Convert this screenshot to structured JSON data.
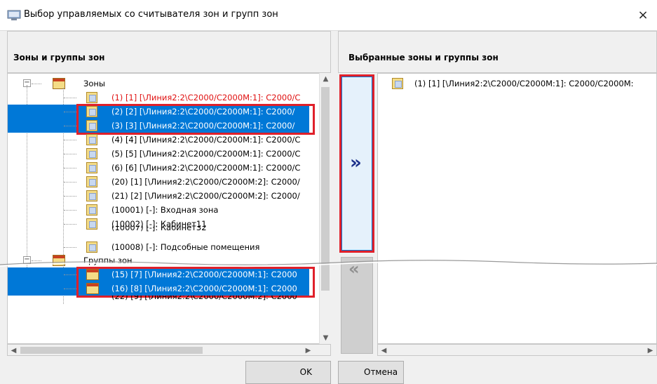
{
  "window": {
    "title": "Выбор управляемых со считывателя зон и групп зон",
    "close_icon": "×"
  },
  "left": {
    "header": "Зоны и группы зон",
    "tree": {
      "zones_label": "Зоны",
      "zones": [
        {
          "text": "(1) [1] [\\Линия2:2\\C2000/C2000M:1]: C2000/C",
          "state": "red"
        },
        {
          "text": "(2) [2] [\\Линия2:2\\C2000/C2000M:1]: C2000/",
          "state": "selected"
        },
        {
          "text": "(3) [3] [\\Линия2:2\\C2000/C2000M:1]: C2000/",
          "state": "selected"
        },
        {
          "text": "(4) [4] [\\Линия2:2\\C2000/C2000M:1]: C2000/C",
          "state": "normal"
        },
        {
          "text": "(5) [5] [\\Линия2:2\\C2000/C2000M:1]: C2000/C",
          "state": "normal"
        },
        {
          "text": "(6) [6] [\\Линия2:2\\C2000/C2000M:1]: C2000/C",
          "state": "normal"
        },
        {
          "text": "(20) [1] [\\Линия2:2\\C2000/C2000M:2]: C2000/",
          "state": "normal"
        },
        {
          "text": "(21) [2] [\\Линия2:2\\C2000/C2000M:2]: C2000/",
          "state": "normal"
        },
        {
          "text": "(10001) [-]: Входная зона",
          "state": "normal"
        },
        {
          "text": "(10002) [-]: Кабинет11",
          "state": "normal"
        },
        {
          "text": "(10007) [-]: Кабинет32",
          "state": "normal"
        },
        {
          "text": "(10008) [-]: Подсобные помещения",
          "state": "normal"
        }
      ],
      "groups_label": "Группы зон",
      "groups": [
        {
          "text": "(15) [7] [\\Линия2:2\\C2000/C2000M:1]: C2000",
          "state": "selected"
        },
        {
          "text": "(16) [8] [\\Линия2:2\\C2000/C2000M:1]: C2000",
          "state": "selected"
        },
        {
          "text": "(22) [9] [\\Линия2:2\\C2000/C2000M:2]: C2000",
          "state": "normal"
        }
      ]
    }
  },
  "middle": {
    "add_label": "»",
    "remove_label": "«"
  },
  "right": {
    "header": "Выбранные зоны и группы зон",
    "items": [
      "(1) [1] [\\Линия2:2\\C2000/C2000M:1]: C2000/C2000M:"
    ]
  },
  "footer": {
    "ok": "OK",
    "cancel": "Отмена"
  },
  "colors": {
    "selection": "#0078d7",
    "highlight_box": "#e0202a",
    "red_text": "#e01010"
  }
}
